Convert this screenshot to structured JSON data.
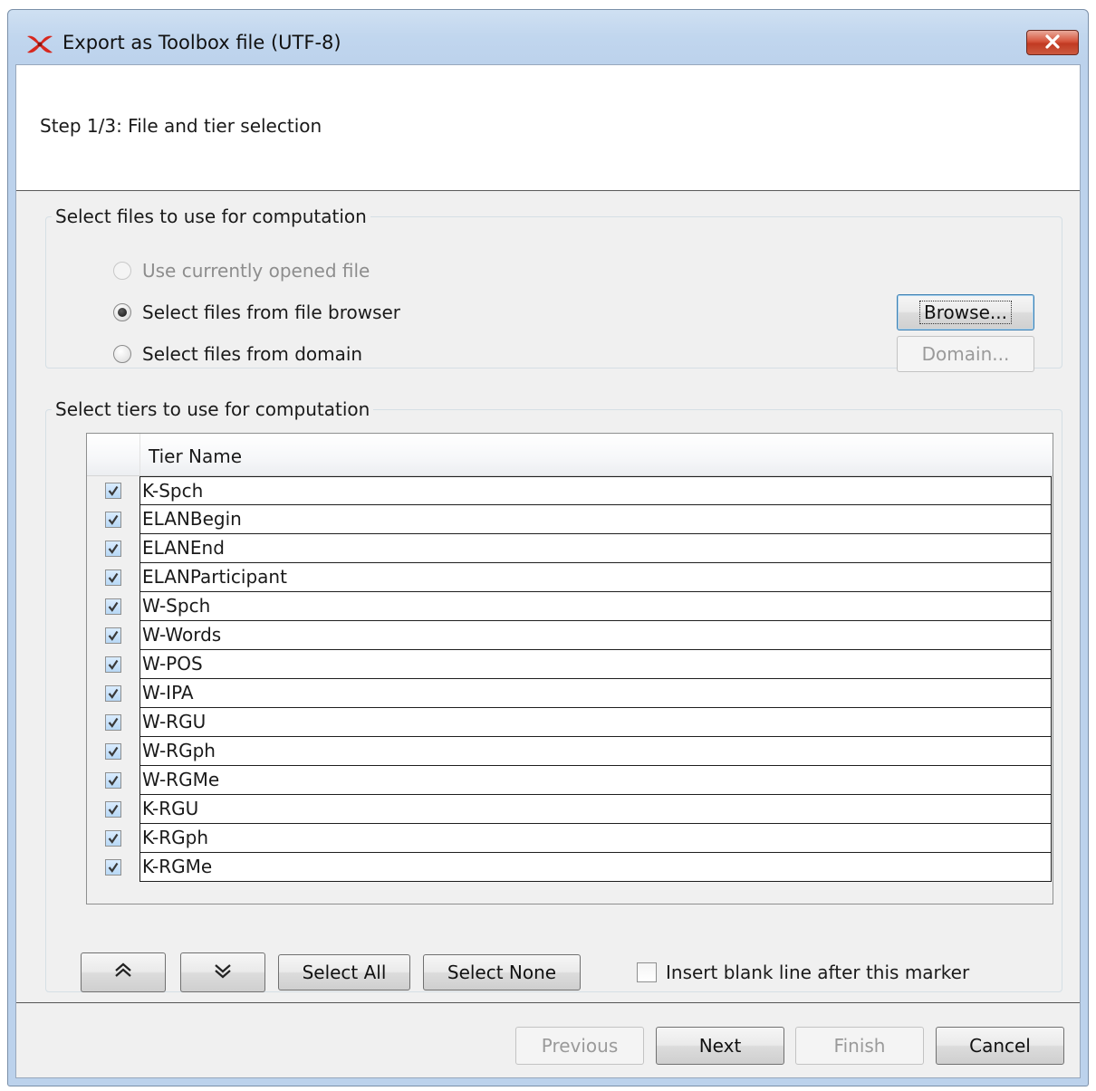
{
  "window": {
    "title": "Export as Toolbox file (UTF-8)",
    "close_icon": "close-x-icon",
    "app_icon": "elan-app-icon"
  },
  "header": {
    "step": "Step 1/3: File and tier selection"
  },
  "files_group": {
    "legend": "Select files to use for computation",
    "options": [
      {
        "label": "Use currently opened file",
        "selected": false,
        "enabled": false
      },
      {
        "label": "Select files from file browser",
        "selected": true,
        "enabled": true
      },
      {
        "label": "Select files from domain",
        "selected": false,
        "enabled": true
      }
    ],
    "browse_label": "Browse...",
    "domain_label": "Domain..."
  },
  "tiers_group": {
    "legend": "Select tiers to use for computation",
    "column_header": "Tier Name",
    "tiers": [
      {
        "name": "K-Spch",
        "checked": true
      },
      {
        "name": "ELANBegin",
        "checked": true
      },
      {
        "name": "ELANEnd",
        "checked": true
      },
      {
        "name": "ELANParticipant",
        "checked": true
      },
      {
        "name": "W-Spch",
        "checked": true
      },
      {
        "name": "W-Words",
        "checked": true
      },
      {
        "name": "W-POS",
        "checked": true
      },
      {
        "name": "W-IPA",
        "checked": true
      },
      {
        "name": "W-RGU",
        "checked": true
      },
      {
        "name": "W-RGph",
        "checked": true
      },
      {
        "name": "W-RGMe",
        "checked": true
      },
      {
        "name": "K-RGU",
        "checked": true
      },
      {
        "name": "K-RGph",
        "checked": true
      },
      {
        "name": "K-RGMe",
        "checked": true
      }
    ],
    "move_up_icon": "double-chevron-up-icon",
    "move_down_icon": "double-chevron-down-icon",
    "select_all_label": "Select All",
    "select_none_label": "Select None",
    "insert_blank_label": "Insert blank line after this marker",
    "insert_blank_checked": false
  },
  "footer": {
    "previous_label": "Previous",
    "next_label": "Next",
    "finish_label": "Finish",
    "cancel_label": "Cancel"
  },
  "colors": {
    "title_bar": "#c1d6ee",
    "dialog_bg": "#f0f0f0",
    "close_button": "#c13a22",
    "check_fill": "#b8d8f5"
  }
}
